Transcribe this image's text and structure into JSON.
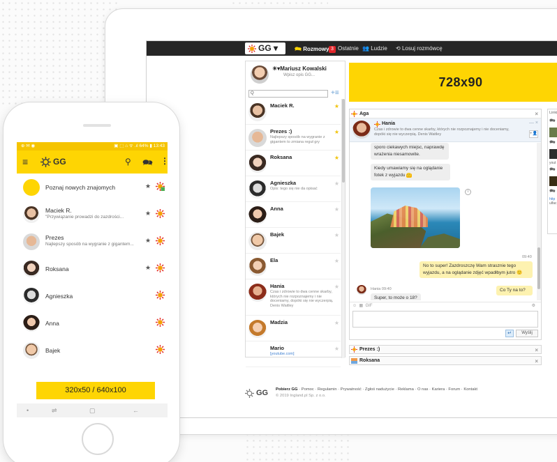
{
  "desktop": {
    "nav": {
      "logo": "GG",
      "items": [
        {
          "label": "Rozmowy"
        },
        {
          "label": "Ostatnie",
          "badge": "3"
        },
        {
          "label": "Ludzie"
        },
        {
          "label": "Losuj rozmówcę"
        }
      ]
    },
    "me": {
      "name": "Mariusz Kowalski",
      "desc": "Wpisz opis GG..."
    },
    "search_placeholder": "Q",
    "contacts": [
      {
        "name": "Maciek R.",
        "desc": "",
        "star": "on"
      },
      {
        "name": "Prezes :)",
        "desc": "Najlepszy sposób na wygranie z gigantem to zmiana reguł gry",
        "star": "on"
      },
      {
        "name": "Roksana",
        "desc": "",
        "star": "on"
      },
      {
        "name": "Agnieszka",
        "desc": "Opis: tego się nie da opisać",
        "star": "off"
      },
      {
        "name": "Anna",
        "desc": "",
        "star": "off"
      },
      {
        "name": "Bajek",
        "desc": "",
        "star": "off"
      },
      {
        "name": "Ela",
        "desc": "",
        "star": "off"
      },
      {
        "name": "Hania",
        "desc": "Czas i zdrowie to dwa cenne skarby, których nie rozpoznajemy i nie doceniamy, dopóki się nie wyczerpią. Denis Waitley",
        "star": "off"
      },
      {
        "name": "Madzia",
        "desc": "",
        "star": "off"
      },
      {
        "name": "Mario",
        "desc": "[youtube.com]",
        "star": "off"
      }
    ],
    "ad_banner": "728x90",
    "chat": {
      "tab_title": "Aga",
      "head_name": "Hania",
      "head_desc": "Czas i zdrowie to dwa cenne skarby, których nie rozpoznajemy i nie doceniamy, dopóki się nie wyczerpią. Denis Waitley",
      "messages": {
        "m1": "sporo ciekawych miejsc, naprawdę wrażenia niesamowite.",
        "m2": "Kiedy umawiamy się na oglądanie fotek z wyjazdu",
        "time1": "09:40",
        "m3": "No to super! Zazdroszczę Wam strasznie tego wyjazdu, a na oglądanie zdjęć wpadłbym jutro",
        "sender2": "Hania 09:40",
        "m4": "Co Ty na to?",
        "m5": "Super, to może o 18?"
      },
      "toolbar": "GIF",
      "send_label": "Wyślij"
    },
    "minimized": [
      "Prezes :)",
      "Roksana"
    ],
    "links_panel": {
      "title": "Linki",
      "link_text": "http",
      "link_sub": "ulfac",
      "yt": "yout"
    },
    "footer": {
      "logo": "GG",
      "download": "Pobierz GG",
      "links": "· Pomoc · Regulamin · Prywatność · Zgłoś nadużycie · Reklama · O nas · Kariera · Forum · Kontakt",
      "copyright": "© 2019 Ingland.pl Sp. z o.o."
    }
  },
  "phone": {
    "status_left": "⊕ ✉ ◉",
    "status_right": "▣ ⬚ ⌂ ᯤ .ıl 64% ▮ 13:43",
    "app_title": "GG",
    "contacts": [
      {
        "name": "Poznaj nowych znajomych",
        "desc": "",
        "star": true,
        "sun": true
      },
      {
        "name": "Maciek R.",
        "desc": "\"Przywiązanie prowadzi do zazdrości...",
        "star": true,
        "sun": true
      },
      {
        "name": "Prezes",
        "desc": "Najlepszy sposób na wygranie z gigantem...",
        "star": true,
        "sun": true
      },
      {
        "name": "Roksana",
        "desc": "",
        "star": true,
        "sun": true
      },
      {
        "name": "Agnieszka",
        "desc": "",
        "star": false,
        "sun": true
      },
      {
        "name": "Anna",
        "desc": "",
        "star": false,
        "sun": true
      },
      {
        "name": "Bajek",
        "desc": "",
        "star": false,
        "sun": true
      }
    ],
    "ad_banner": "320x50 / 640x100"
  },
  "colors": {
    "brand_yellow": "#fed503",
    "dark_nav": "#262626",
    "badge_red": "#e1252a",
    "star_gold": "#f1c40f"
  }
}
